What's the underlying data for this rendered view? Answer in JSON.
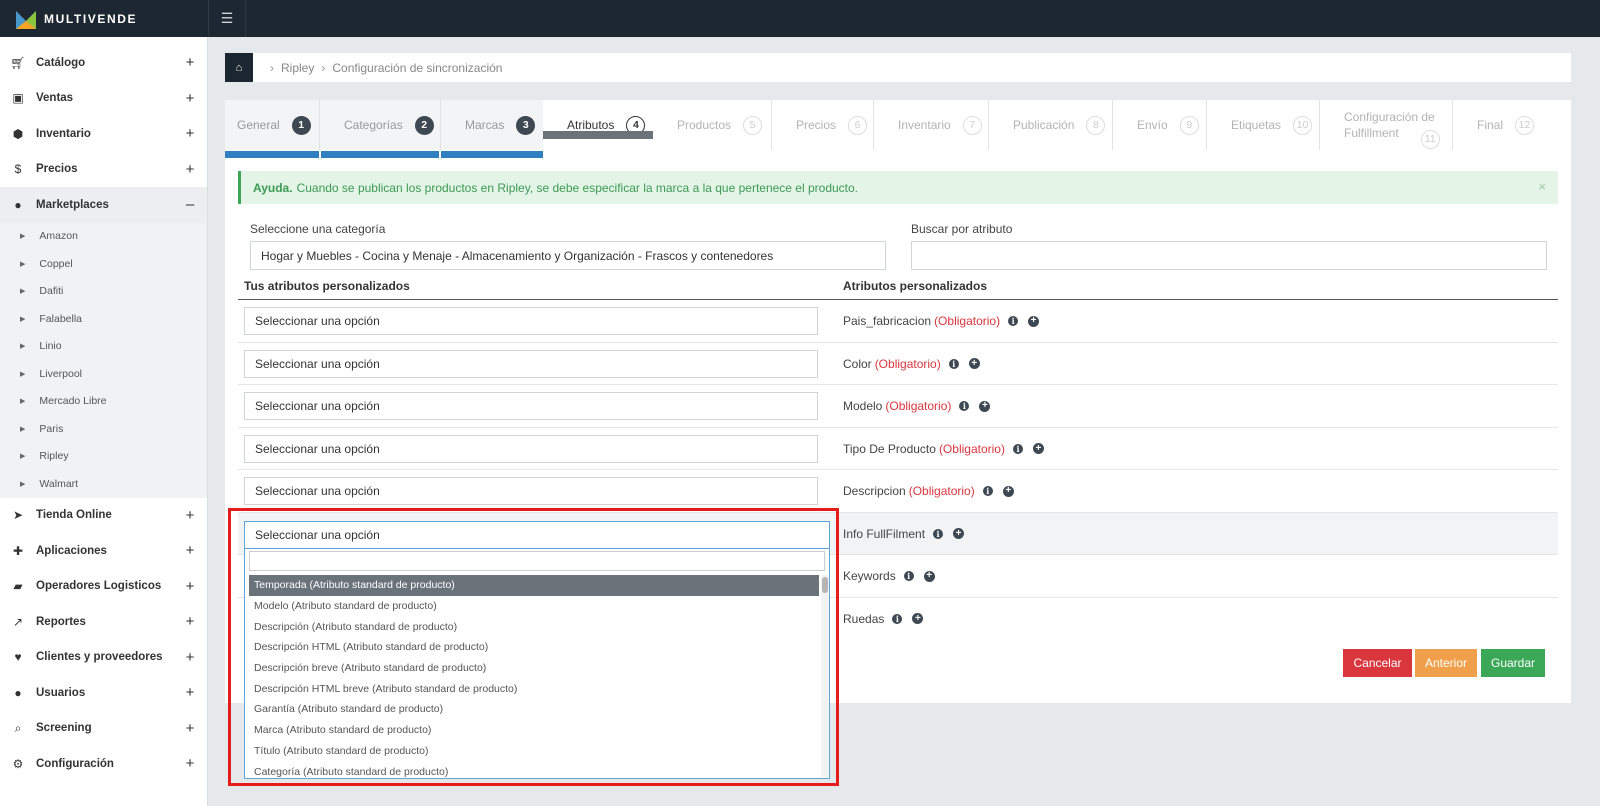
{
  "brand": {
    "name": "MULTIVENDE"
  },
  "sidebar": {
    "items": [
      {
        "label": "Catálogo",
        "icon": "cart-icon",
        "toggle": "+"
      },
      {
        "label": "Ventas",
        "icon": "money-icon",
        "toggle": "+"
      },
      {
        "label": "Inventario",
        "icon": "cubes-icon",
        "toggle": "+"
      },
      {
        "label": "Precios",
        "icon": "dollar-icon",
        "toggle": "+"
      },
      {
        "label": "Marketplaces",
        "icon": "globe-icon",
        "toggle": "–"
      },
      {
        "label": "Tienda Online",
        "icon": "cursor-icon",
        "toggle": "+"
      },
      {
        "label": "Aplicaciones",
        "icon": "puzzle-icon",
        "toggle": "+"
      },
      {
        "label": "Operadores Logisticos",
        "icon": "truck-icon",
        "toggle": "+"
      },
      {
        "label": "Reportes",
        "icon": "chart-icon",
        "toggle": "+"
      },
      {
        "label": "Clientes y proveedores",
        "icon": "heart-icon",
        "toggle": "+"
      },
      {
        "label": "Usuarios",
        "icon": "user-icon",
        "toggle": "+"
      },
      {
        "label": "Screening",
        "icon": "search-icon",
        "toggle": "+"
      },
      {
        "label": "Configuración",
        "icon": "gear-icon",
        "toggle": "+"
      }
    ],
    "marketplaces": [
      "Amazon",
      "Coppel",
      "Dafiti",
      "Falabella",
      "Linio",
      "Liverpool",
      "Mercado Libre",
      "Paris",
      "Ripley",
      "Walmart"
    ]
  },
  "breadcrumb": {
    "items": [
      "Ripley",
      "Configuración de sincronización"
    ]
  },
  "steps": [
    {
      "label": "General",
      "num": "1"
    },
    {
      "label": "Categorías",
      "num": "2"
    },
    {
      "label": "Marcas",
      "num": "3"
    },
    {
      "label": "Atributos",
      "num": "4"
    },
    {
      "label": "Productos",
      "num": "5"
    },
    {
      "label": "Precios",
      "num": "6"
    },
    {
      "label": "Inventario",
      "num": "7"
    },
    {
      "label": "Publicación",
      "num": "8"
    },
    {
      "label": "Envío",
      "num": "9"
    },
    {
      "label": "Etiquetas",
      "num": "10"
    },
    {
      "label1": "Configuración de",
      "label2": "Fulfillment",
      "num": "11"
    },
    {
      "label": "Final",
      "num": "12"
    }
  ],
  "alert": {
    "title": "Ayuda.",
    "text": "Cuando se publican los productos en Ripley, se debe especificar la marca a la que pertenece el producto.",
    "close": "×"
  },
  "form": {
    "category_label": "Seleccione una categoría",
    "category_value": "Hogar y Muebles - Cocina y Menaje - Almacenamiento y Organización - Frascos y contenedores",
    "search_label": "Buscar por atributo",
    "search_value": ""
  },
  "table": {
    "left_header": "Tus atributos personalizados",
    "right_header": "Atributos personalizados",
    "placeholder": "Seleccionar una opción",
    "required_text": "(Obligatorio)",
    "rows": [
      {
        "name": "Pais_fabricacion",
        "required": true
      },
      {
        "name": "Color",
        "required": true
      },
      {
        "name": "Modelo",
        "required": true
      },
      {
        "name": "Tipo De Producto",
        "required": true
      },
      {
        "name": "Descripcion",
        "required": true
      },
      {
        "name": "Info FullFilment",
        "required": false
      },
      {
        "name": "Keywords",
        "required": false
      },
      {
        "name": "Ruedas",
        "required": false
      }
    ]
  },
  "buttons": {
    "cancel": "Cancelar",
    "previous": "Anterior",
    "save": "Guardar"
  },
  "dropdown": {
    "selected_text": "Seleccionar una opción",
    "search_value": "",
    "options": [
      "Temporada (Atributo standard de producto)",
      "Modelo (Atributo standard de producto)",
      "Descripción (Atributo standard de producto)",
      "Descripción HTML (Atributo standard de producto)",
      "Descripción breve (Atributo standard de producto)",
      "Descripción HTML breve (Atributo standard de producto)",
      "Garantía (Atributo standard de producto)",
      "Marca (Atributo standard de producto)",
      "Título (Atributo standard de producto)",
      "Categoría (Atributo standard de producto)"
    ],
    "highlighted_index": 0
  },
  "colors": {
    "topbar": "#1c2731",
    "progress": "#2f7fc1",
    "progress_current": "#6b737a",
    "required": "#d9363e",
    "alert_green": "#3aa857",
    "highlight_frame": "#e41c1c"
  }
}
